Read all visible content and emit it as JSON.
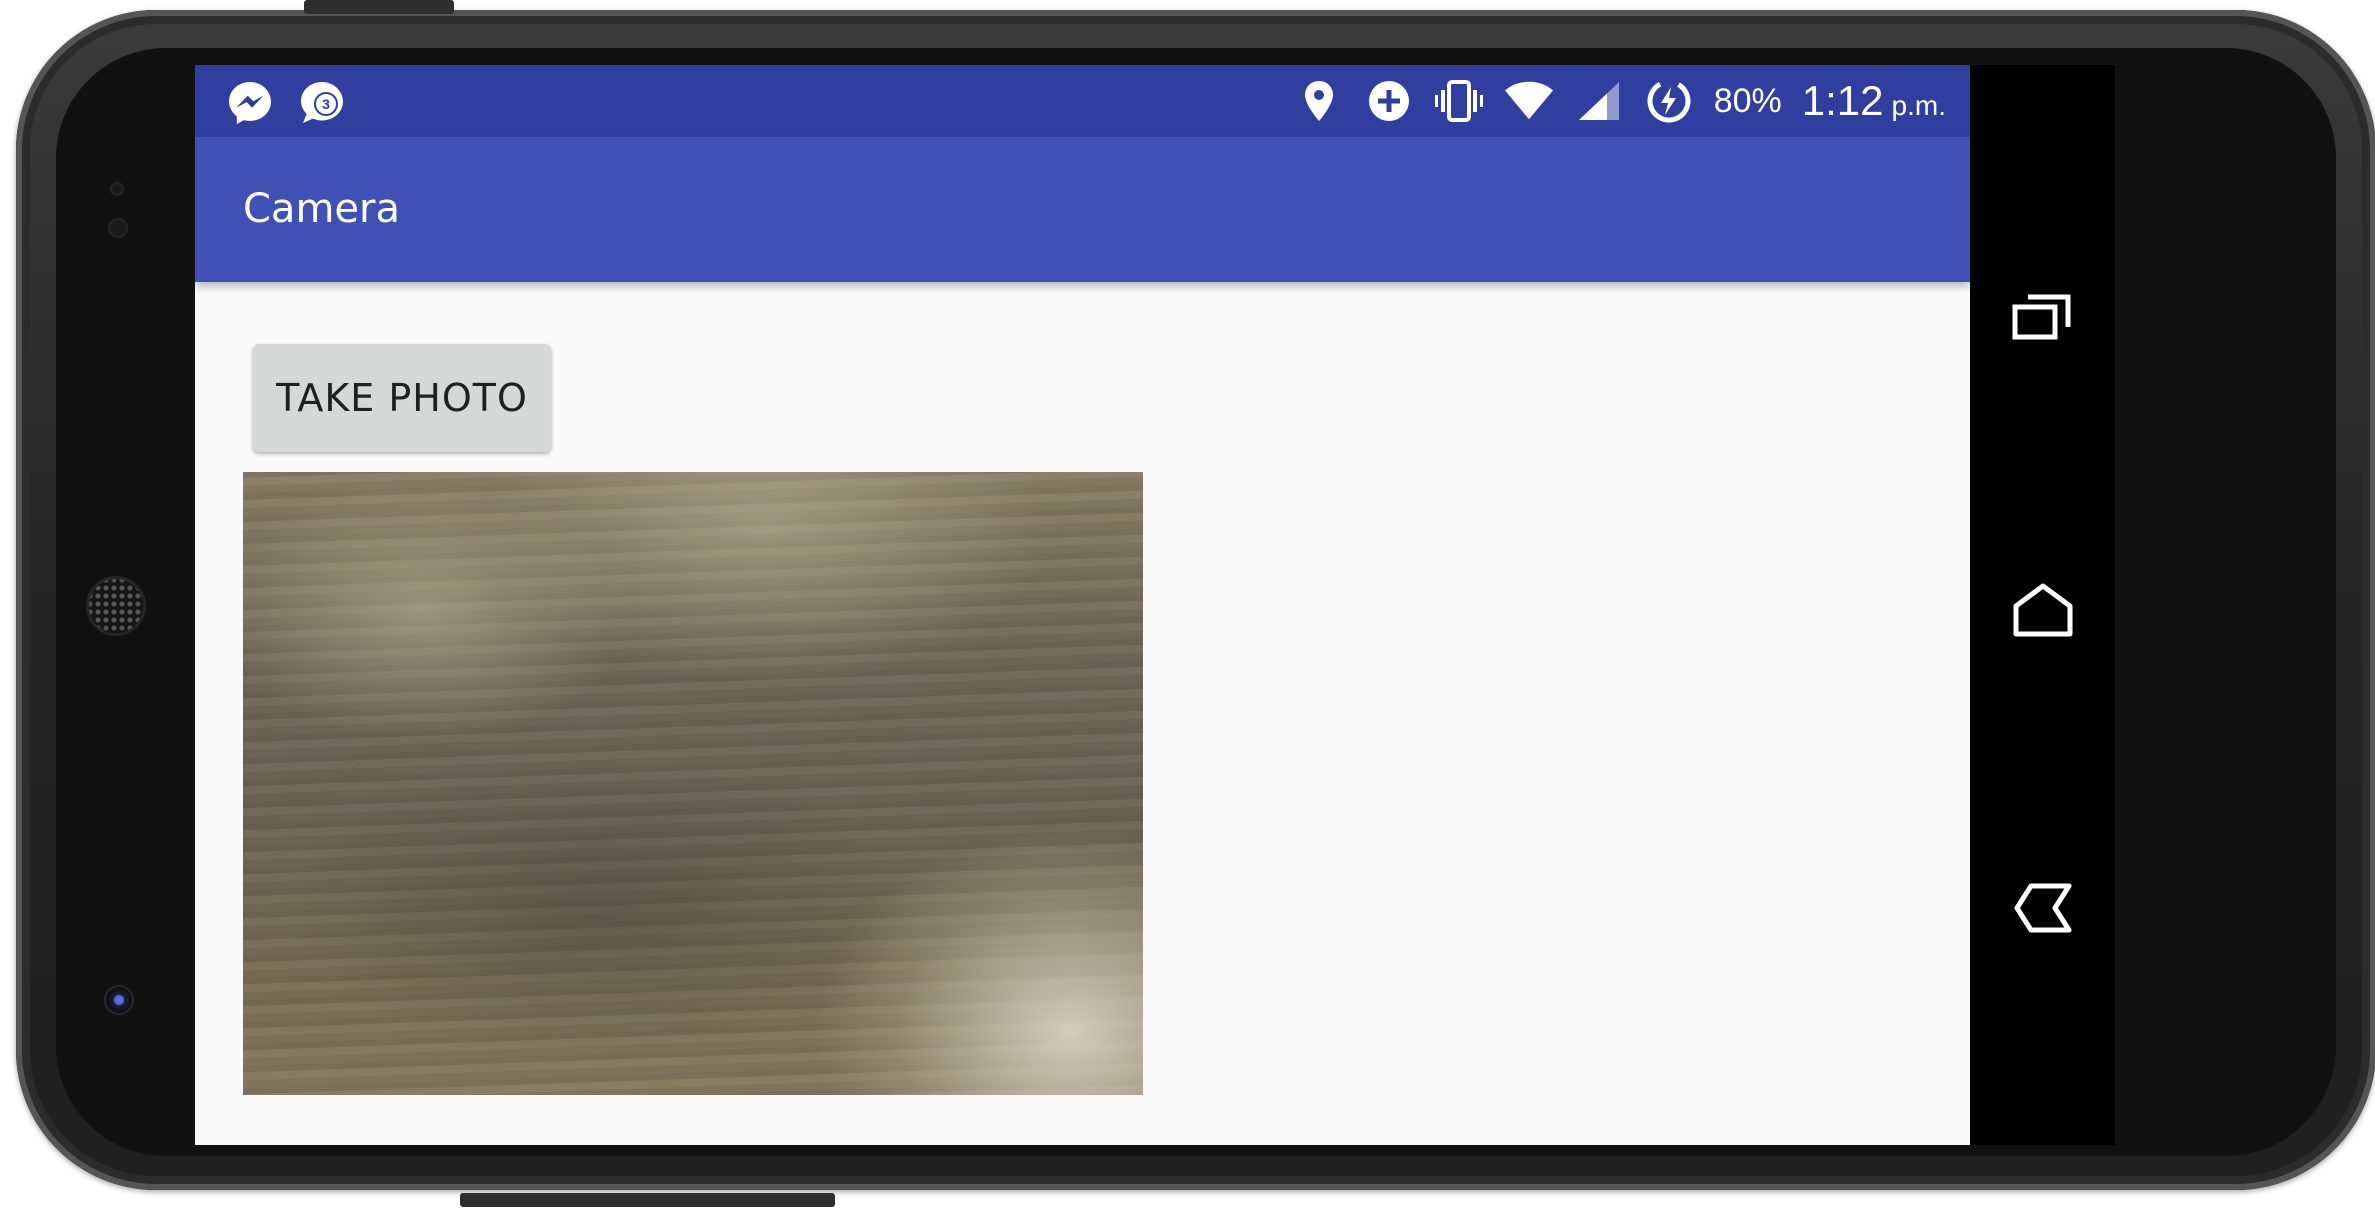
{
  "status_bar": {
    "notifications": [
      {
        "icon": "messenger-icon"
      },
      {
        "icon": "chat-badge-icon",
        "badge": "3"
      }
    ],
    "system_icons": [
      "location-icon",
      "data-saver-icon",
      "vibrate-icon",
      "wifi-icon",
      "cell-signal-icon",
      "battery-saver-icon"
    ],
    "battery_percent": "80%",
    "time": "1:12",
    "ampm": "p.m."
  },
  "app_bar": {
    "title": "Camera"
  },
  "main": {
    "take_photo_label": "TAKE PHOTO",
    "photo_description": "wood-surface-photo"
  },
  "nav_bar": {
    "buttons": [
      "recents-icon",
      "home-icon",
      "back-icon"
    ]
  },
  "colors": {
    "status_bar": "#303f9f",
    "app_bar": "#3f51b5",
    "content_bg": "#fafafa",
    "button_bg": "#d6d7d7"
  }
}
